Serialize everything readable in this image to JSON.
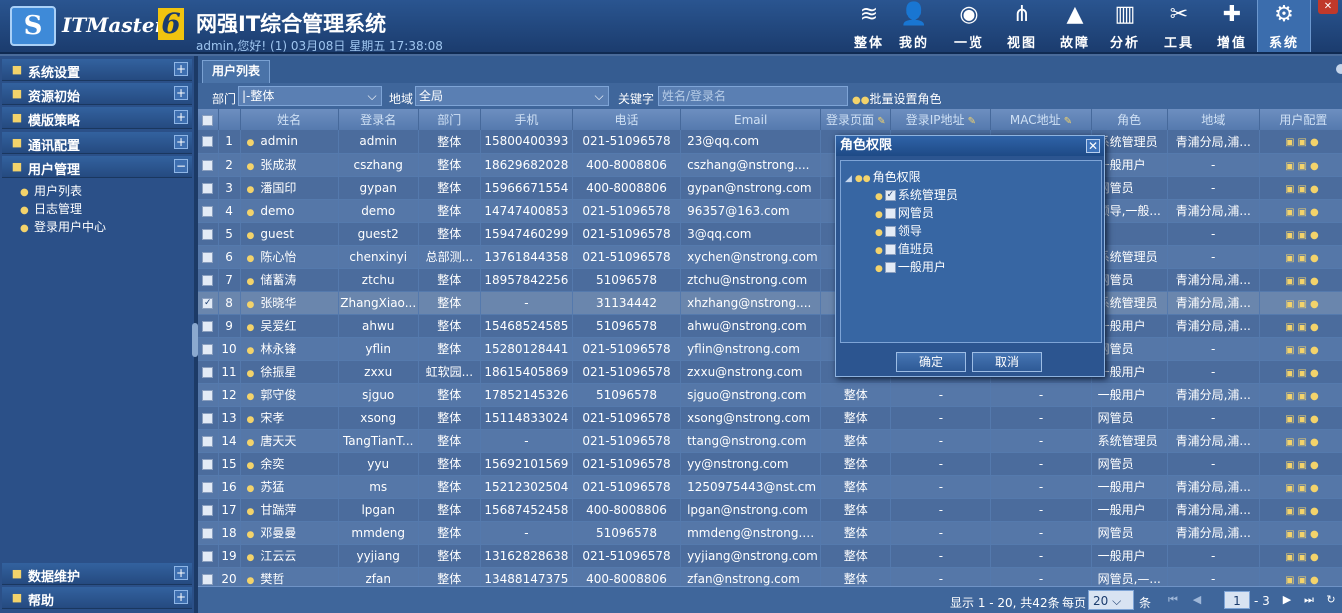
{
  "header": {
    "logo_letter": "S",
    "brand": "ITMaster",
    "brand_version": "6",
    "title": "网强IT综合管理系统",
    "welcome": "admin,您好! (1) 03月08日 星期五 17:38:08",
    "nav": [
      {
        "label": "整体",
        "icon": "layers-icon",
        "glyph": "≋"
      },
      {
        "label": "我的",
        "icon": "user-icon",
        "glyph": "👤"
      },
      {
        "label": "一览",
        "icon": "dashboard-icon",
        "glyph": "◉"
      },
      {
        "label": "视图",
        "icon": "network-icon",
        "glyph": "⋔"
      },
      {
        "label": "故障",
        "icon": "warning-icon",
        "glyph": "▲"
      },
      {
        "label": "分析",
        "icon": "chart-icon",
        "glyph": "▥"
      },
      {
        "label": "工具",
        "icon": "tools-icon",
        "glyph": "✂"
      },
      {
        "label": "增值",
        "icon": "plus-icon",
        "glyph": "✚"
      },
      {
        "label": "系统",
        "icon": "gear-icon",
        "glyph": "⚙"
      }
    ],
    "active_nav": "系统"
  },
  "sidebar": {
    "sections": [
      {
        "label": "系统设置",
        "icon": "monitor-icon",
        "toggle": "+"
      },
      {
        "label": "资源初始",
        "icon": "resource-icon",
        "toggle": "+"
      },
      {
        "label": "模版策略",
        "icon": "template-icon",
        "toggle": "+"
      },
      {
        "label": "通讯配置",
        "icon": "communication-icon",
        "toggle": "+"
      },
      {
        "label": "用户管理",
        "icon": "users-icon",
        "toggle": "−"
      }
    ],
    "sub_items": [
      {
        "label": "用户列表",
        "icon": "user-icon"
      },
      {
        "label": "日志管理",
        "icon": "log-icon"
      },
      {
        "label": "登录用户中心",
        "icon": "users-icon"
      }
    ],
    "bottom_sections": [
      {
        "label": "数据维护",
        "icon": "database-icon",
        "toggle": "+"
      },
      {
        "label": "帮助",
        "icon": "help-icon",
        "toggle": "+"
      }
    ]
  },
  "tab": {
    "label": "用户列表"
  },
  "filter": {
    "dept_label": "部门",
    "dept_value": "|-整体",
    "region_label": "地域",
    "region_value": "全局",
    "keyword_label": "关键字",
    "keyword_placeholder": "姓名/登录名",
    "batch_label": "批量设置角色"
  },
  "table": {
    "columns": [
      "",
      "",
      "姓名",
      "登录名",
      "部门",
      "手机",
      "电话",
      "Email",
      "登录页面",
      "登录IP地址",
      "MAC地址",
      "角色",
      "地域",
      "用户配置"
    ],
    "rows": [
      {
        "no": "1",
        "checked": false,
        "name": "admin",
        "login": "admin",
        "dept": "整体",
        "mobile": "15800400393",
        "phone": "021-51096578",
        "email": "23@qq.com",
        "page": "",
        "ip": "",
        "mac": "",
        "role": "系统管理员",
        "region": "青浦分局,浦..."
      },
      {
        "no": "2",
        "checked": false,
        "name": "张成淑",
        "login": "cszhang",
        "dept": "整体",
        "mobile": "18629682028",
        "phone": "400-8008806",
        "email": "cszhang@nstrong....",
        "page": "",
        "ip": "",
        "mac": "",
        "role": "一般用户",
        "region": "-"
      },
      {
        "no": "3",
        "checked": false,
        "name": "潘国印",
        "login": "gypan",
        "dept": "整体",
        "mobile": "15966671554",
        "phone": "400-8008806",
        "email": "gypan@nstrong.com",
        "page": "",
        "ip": "",
        "mac": "",
        "role": "网管员",
        "region": "-"
      },
      {
        "no": "4",
        "checked": false,
        "name": "demo",
        "login": "demo",
        "dept": "整体",
        "mobile": "14747400853",
        "phone": "021-51096578",
        "email": "96357@163.com",
        "page": "",
        "ip": "",
        "mac": "",
        "role": "领导,一般...",
        "region": "青浦分局,浦..."
      },
      {
        "no": "5",
        "checked": false,
        "name": "guest",
        "login": "guest2",
        "dept": "整体",
        "mobile": "15947460299",
        "phone": "021-51096578",
        "email": "3@qq.com",
        "page": "",
        "ip": "",
        "mac": "",
        "role": "",
        "region": "-"
      },
      {
        "no": "6",
        "checked": false,
        "name": "陈心怡",
        "login": "chenxinyi",
        "dept": "总部测...",
        "mobile": "13761844358",
        "phone": "021-51096578",
        "email": "xychen@nstrong.com",
        "page": "",
        "ip": "",
        "mac": "",
        "role": "系统管理员",
        "region": "-"
      },
      {
        "no": "7",
        "checked": false,
        "name": "储蓄涛",
        "login": "ztchu",
        "dept": "整体",
        "mobile": "18957842256",
        "phone": "51096578",
        "email": "ztchu@nstrong.com",
        "page": "",
        "ip": "",
        "mac": "",
        "role": "网管员",
        "region": "青浦分局,浦..."
      },
      {
        "no": "8",
        "checked": true,
        "name": "张晓华",
        "login": "ZhangXiao...",
        "dept": "整体",
        "mobile": "-",
        "phone": "31134442",
        "email": "xhzhang@nstrong....",
        "page": "",
        "ip": "",
        "mac": "",
        "role": "系统管理员",
        "region": "青浦分局,浦..."
      },
      {
        "no": "9",
        "checked": false,
        "name": "吴爱红",
        "login": "ahwu",
        "dept": "整体",
        "mobile": "15468524585",
        "phone": "51096578",
        "email": "ahwu@nstrong.com",
        "page": "",
        "ip": "",
        "mac": "",
        "role": "一般用户",
        "region": "青浦分局,浦..."
      },
      {
        "no": "10",
        "checked": false,
        "name": "林永锋",
        "login": "yflin",
        "dept": "整体",
        "mobile": "15280128441",
        "phone": "021-51096578",
        "email": "yflin@nstrong.com",
        "page": "",
        "ip": "",
        "mac": "",
        "role": "网管员",
        "region": "-"
      },
      {
        "no": "11",
        "checked": false,
        "name": "徐振星",
        "login": "zxxu",
        "dept": "虹软园...",
        "mobile": "18615405869",
        "phone": "021-51096578",
        "email": "zxxu@nstrong.com",
        "page": "",
        "ip": "",
        "mac": "",
        "role": "一般用户",
        "region": "-"
      },
      {
        "no": "12",
        "checked": false,
        "name": "郭守俊",
        "login": "sjguo",
        "dept": "整体",
        "mobile": "17852145326",
        "phone": "51096578",
        "email": "sjguo@nstrong.com",
        "page": "整体",
        "ip": "-",
        "mac": "-",
        "role": "一般用户",
        "region": "青浦分局,浦..."
      },
      {
        "no": "13",
        "checked": false,
        "name": "宋孝",
        "login": "xsong",
        "dept": "整体",
        "mobile": "15114833024",
        "phone": "021-51096578",
        "email": "xsong@nstrong.com",
        "page": "整体",
        "ip": "-",
        "mac": "-",
        "role": "网管员",
        "region": "-"
      },
      {
        "no": "14",
        "checked": false,
        "name": "唐天天",
        "login": "TangTianT...",
        "dept": "整体",
        "mobile": "-",
        "phone": "021-51096578",
        "email": "ttang@nstrong.com",
        "page": "整体",
        "ip": "-",
        "mac": "-",
        "role": "系统管理员",
        "region": "青浦分局,浦..."
      },
      {
        "no": "15",
        "checked": false,
        "name": "余奕",
        "login": "yyu",
        "dept": "整体",
        "mobile": "15692101569",
        "phone": "021-51096578",
        "email": "yy@nstrong.com",
        "page": "整体",
        "ip": "-",
        "mac": "-",
        "role": "网管员",
        "region": "-"
      },
      {
        "no": "16",
        "checked": false,
        "name": "苏猛",
        "login": "ms",
        "dept": "整体",
        "mobile": "15212302504",
        "phone": "021-51096578",
        "email": "1250975443@nst.cm",
        "page": "整体",
        "ip": "-",
        "mac": "-",
        "role": "一般用户",
        "region": "青浦分局,浦..."
      },
      {
        "no": "17",
        "checked": false,
        "name": "甘踹萍",
        "login": "lpgan",
        "dept": "整体",
        "mobile": "15687452458",
        "phone": "400-8008806",
        "email": "lpgan@nstrong.com",
        "page": "整体",
        "ip": "-",
        "mac": "-",
        "role": "一般用户",
        "region": "青浦分局,浦..."
      },
      {
        "no": "18",
        "checked": false,
        "name": "邓曼曼",
        "login": "mmdeng",
        "dept": "整体",
        "mobile": "-",
        "phone": "51096578",
        "email": "mmdeng@nstrong.com",
        "page": "整体",
        "ip": "-",
        "mac": "-",
        "role": "网管员",
        "region": "青浦分局,浦..."
      },
      {
        "no": "19",
        "checked": false,
        "name": "江云云",
        "login": "yyjiang",
        "dept": "整体",
        "mobile": "13162828638",
        "phone": "021-51096578",
        "email": "yyjiang@nstrong.com",
        "page": "整体",
        "ip": "-",
        "mac": "-",
        "role": "一般用户",
        "region": "-"
      },
      {
        "no": "20",
        "checked": false,
        "name": "樊哲",
        "login": "zfan",
        "dept": "整体",
        "mobile": "13488147375",
        "phone": "400-8008806",
        "email": "zfan@nstrong.com",
        "page": "整体",
        "ip": "-",
        "mac": "-",
        "role": "网管员,—...",
        "region": "-"
      }
    ]
  },
  "pager": {
    "summary": "显示 1 - 20, 共42条",
    "per_page_label": "每页",
    "per_page_value": "20",
    "unit": "条",
    "page": "1",
    "total_pages": "- 3"
  },
  "dialog": {
    "title": "角色权限",
    "root": "角色权限",
    "roles": [
      {
        "label": "系统管理员",
        "checked": true
      },
      {
        "label": "网管员",
        "checked": false
      },
      {
        "label": "领导",
        "checked": false
      },
      {
        "label": "值班员",
        "checked": false
      },
      {
        "label": "一般用户",
        "checked": false
      }
    ],
    "ok": "确定",
    "cancel": "取消"
  }
}
